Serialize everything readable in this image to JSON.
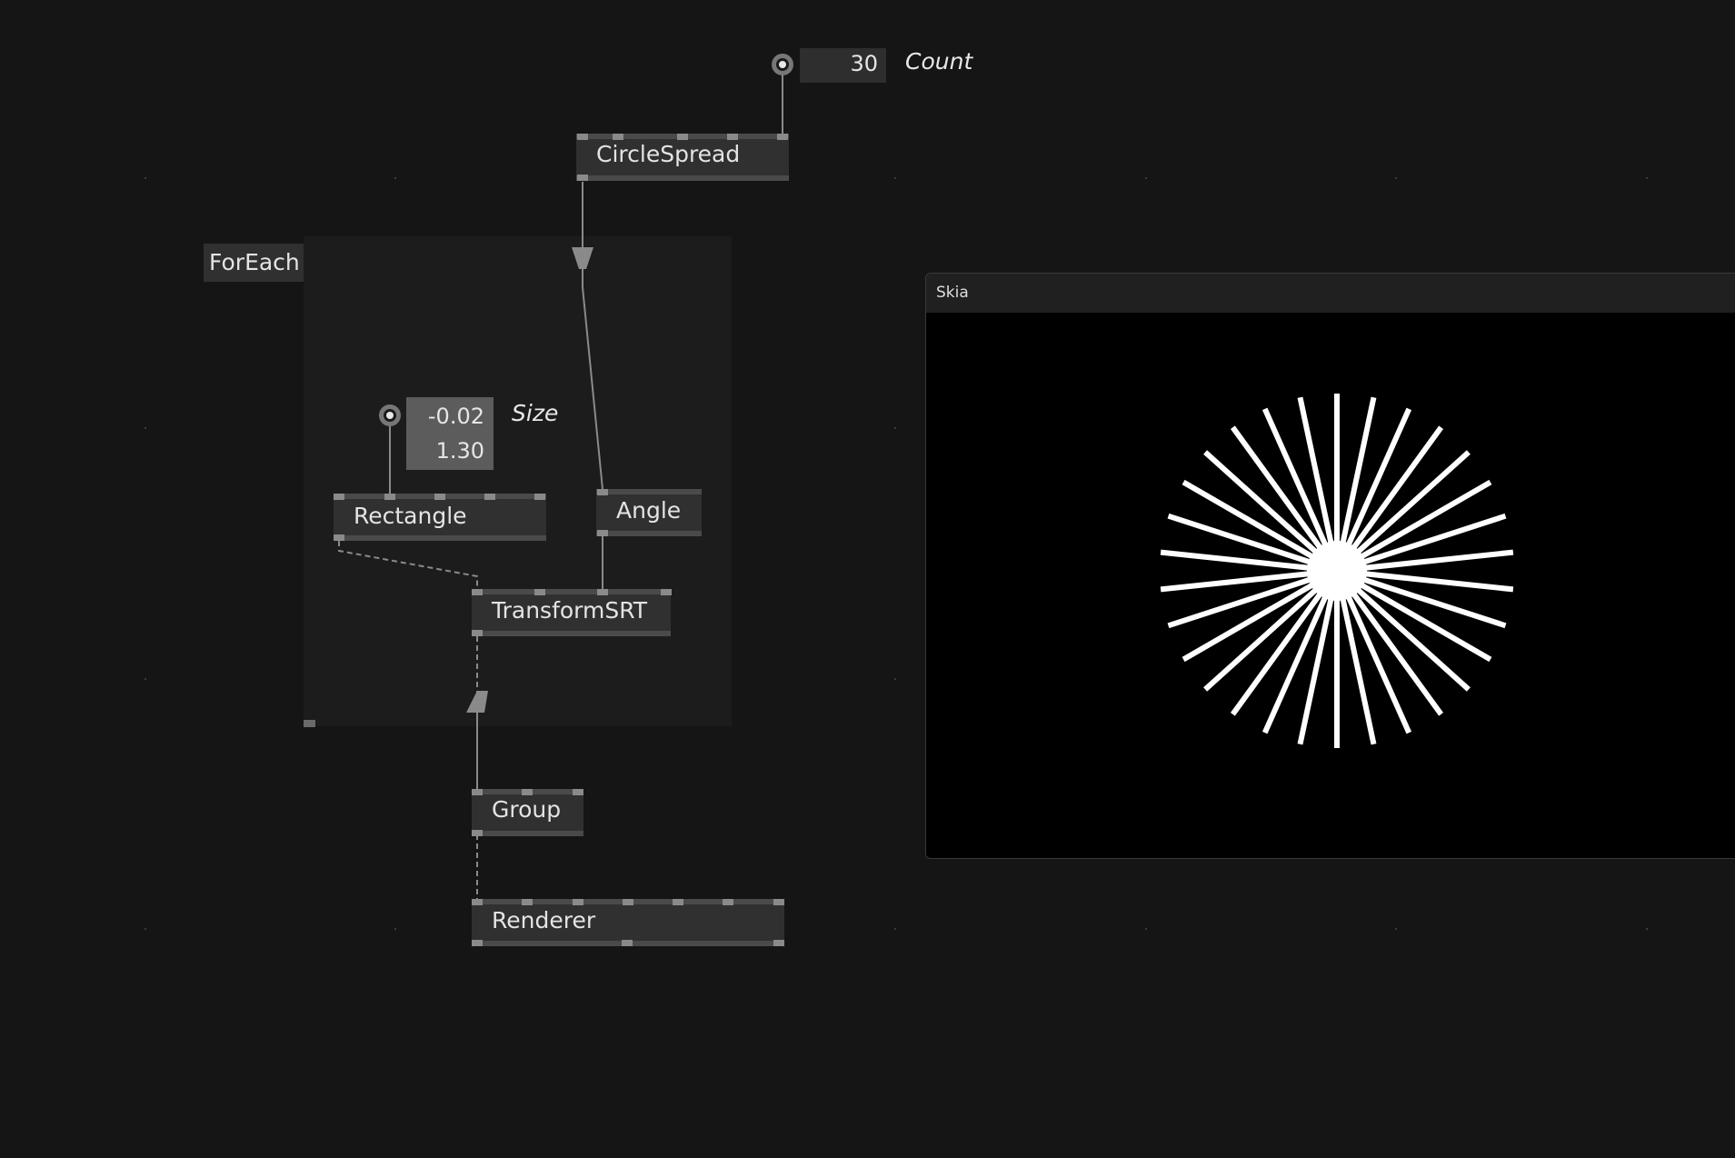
{
  "window": {
    "title": "Skia"
  },
  "region": {
    "label": "ForEach"
  },
  "nodes": {
    "circlespread": "CircleSpread",
    "rectangle": "Rectangle",
    "angle": "Angle",
    "transformsrt": "TransformSRT",
    "group": "Group",
    "renderer": "Renderer"
  },
  "pads": {
    "count": {
      "name": "Count",
      "value": "30"
    },
    "size": {
      "name": "Size",
      "x": "-0.02",
      "y": "1.30"
    }
  },
  "render": {
    "spoke_count": 30,
    "shape_size": [
      -0.02,
      1.3
    ]
  },
  "colors": {
    "background": "#151515",
    "node": "#303030",
    "region": "#1c1c1c",
    "link": "#8a8a8a",
    "spoke": "#ffffff"
  }
}
